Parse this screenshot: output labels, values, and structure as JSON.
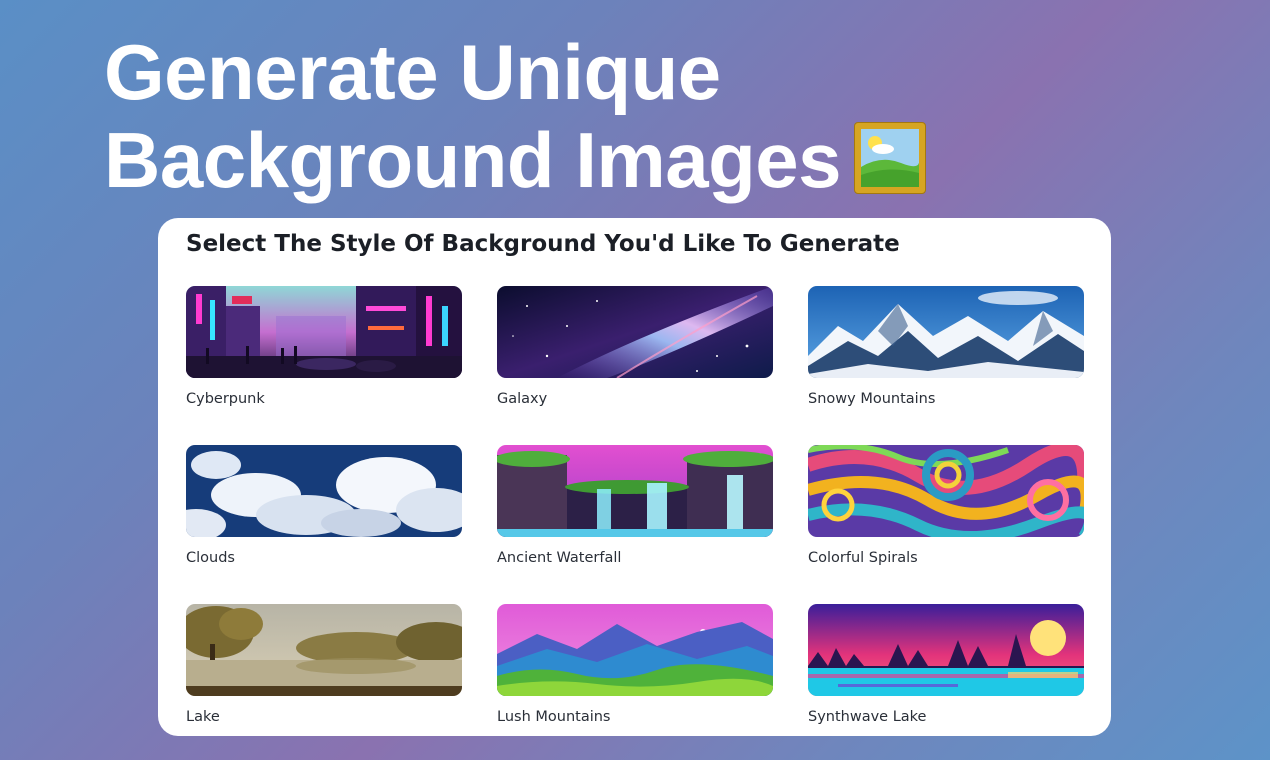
{
  "hero": {
    "line1": "Generate Unique",
    "line2": "Background Images",
    "emoji_icon": "framed-picture-icon"
  },
  "panel": {
    "heading": "Select The Style Of Background You'd Like To Generate"
  },
  "styles": [
    {
      "label": "Cyberpunk",
      "icon": "cyberpunk-city-thumbnail"
    },
    {
      "label": "Galaxy",
      "icon": "galaxy-thumbnail"
    },
    {
      "label": "Snowy Mountains",
      "icon": "snowy-mountains-thumbnail"
    },
    {
      "label": "Clouds",
      "icon": "clouds-thumbnail"
    },
    {
      "label": "Ancient Waterfall",
      "icon": "ancient-waterfall-thumbnail"
    },
    {
      "label": "Colorful Spirals",
      "icon": "colorful-spirals-thumbnail"
    },
    {
      "label": "Lake",
      "icon": "lake-thumbnail"
    },
    {
      "label": "Lush Mountains",
      "icon": "lush-mountains-thumbnail"
    },
    {
      "label": "Synthwave Lake",
      "icon": "synthwave-lake-thumbnail"
    }
  ],
  "colors": {
    "text_primary": "#1b1f26",
    "panel_bg": "#ffffff",
    "hero_text": "#ffffff"
  }
}
